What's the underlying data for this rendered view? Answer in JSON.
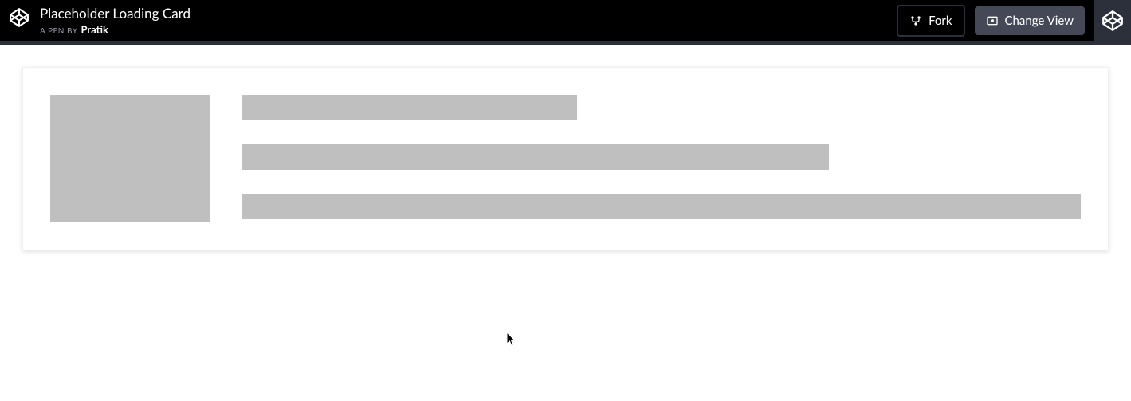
{
  "header": {
    "pen_title": "Placeholder Loading Card",
    "by_label": "A Pen by",
    "author": "Pratik",
    "fork_label": "Fork",
    "change_view_label": "Change View"
  }
}
